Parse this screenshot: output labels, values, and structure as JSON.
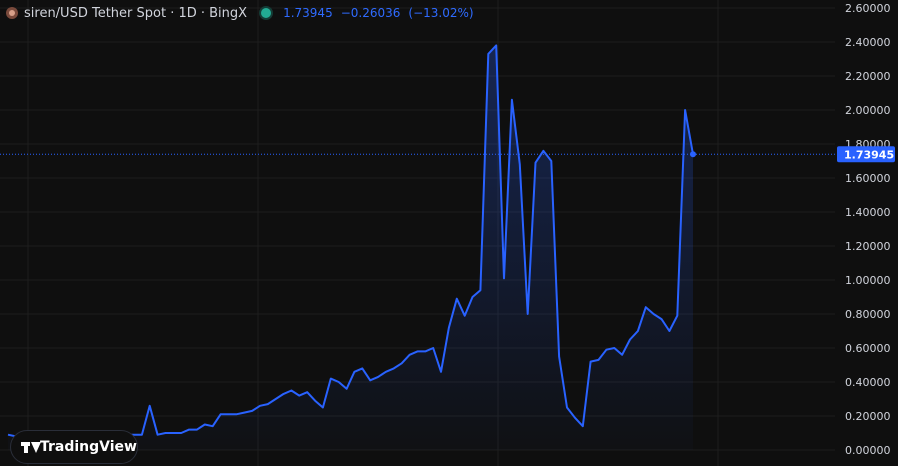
{
  "legend": {
    "title": "siren/USD Tether Spot · 1D · BingX",
    "last": "1.73945",
    "change": "−0.26036",
    "change_pct": "(−13.02%)"
  },
  "price_label": "1.73945",
  "brand": "TradingView",
  "colors": {
    "line": "#2962ff",
    "accent": "#2f6bff",
    "background": "#0f0f0f",
    "grid": "#1e1e1e"
  },
  "chart_data": {
    "type": "area",
    "title": "",
    "xlabel": "",
    "ylabel": "",
    "ylim": [
      0,
      2.6
    ],
    "y_ticks": [
      "2.60000",
      "2.40000",
      "2.20000",
      "2.00000",
      "1.80000",
      "1.60000",
      "1.40000",
      "1.20000",
      "1.00000",
      "0.80000",
      "0.60000",
      "0.40000",
      "0.20000",
      "0.00000"
    ],
    "last_value": 1.73945,
    "grid": true,
    "series": [
      {
        "values": [
          0.09,
          0.08,
          0.07,
          0.08,
          0.08,
          0.09,
          0.09,
          0.08,
          0.08,
          0.08,
          0.09,
          0.07,
          0.08,
          0.08,
          0.09,
          0.09,
          0.09,
          0.09,
          0.26,
          0.09,
          0.1,
          0.1,
          0.1,
          0.12,
          0.12,
          0.15,
          0.14,
          0.21,
          0.21,
          0.21,
          0.22,
          0.23,
          0.26,
          0.27,
          0.3,
          0.33,
          0.35,
          0.32,
          0.34,
          0.29,
          0.25,
          0.42,
          0.4,
          0.36,
          0.46,
          0.48,
          0.41,
          0.43,
          0.46,
          0.48,
          0.51,
          0.56,
          0.58,
          0.58,
          0.6,
          0.46,
          0.72,
          0.89,
          0.79,
          0.9,
          0.94,
          2.33,
          2.38,
          1.01,
          2.06,
          1.68,
          0.8,
          1.69,
          1.76,
          1.7,
          0.55,
          0.25,
          0.19,
          0.14,
          0.52,
          0.53,
          0.59,
          0.6,
          0.56,
          0.65,
          0.7,
          0.84,
          0.8,
          0.77,
          0.7,
          0.79,
          2.0,
          1.73945
        ]
      }
    ]
  }
}
